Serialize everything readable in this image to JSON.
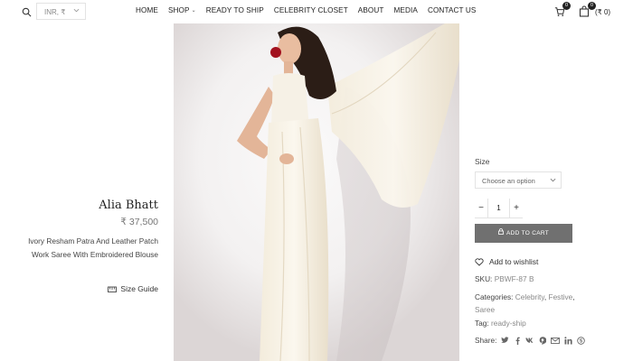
{
  "header": {
    "currency": "INR, ₹",
    "nav": [
      {
        "label": "HOME",
        "dropdown": false
      },
      {
        "label": "SHOP",
        "dropdown": true
      },
      {
        "label": "READY TO SHIP",
        "dropdown": false
      },
      {
        "label": "CELEBRITY CLOSET",
        "dropdown": false
      },
      {
        "label": "ABOUT",
        "dropdown": false
      },
      {
        "label": "MEDIA",
        "dropdown": false
      },
      {
        "label": "CONTACT US",
        "dropdown": false
      }
    ],
    "wishlist_count": "0",
    "cart_count": "0",
    "cart_total": "(₹ 0)"
  },
  "product": {
    "title": "Alia Bhatt",
    "price": "₹ 37,500",
    "description": "Ivory Resham Patra And Leather Patch Work Saree With Embroidered Blouse",
    "size_guide": "Size Guide",
    "size_label": "Size",
    "size_placeholder": "Choose an option",
    "quantity": "1",
    "qty_minus": "−",
    "qty_plus": "+",
    "add_to_cart": "ADD TO CART",
    "wishlist": "Add to wishlist",
    "sku_label": "SKU:",
    "sku": "PBWF-87 B",
    "categories_label": "Categories:",
    "categories": [
      "Celebrity",
      "Festive",
      "Saree"
    ],
    "tag_label": "Tag:",
    "tag": "ready-ship",
    "share_label": "Share:"
  },
  "share_icons": [
    "twitter-icon",
    "facebook-icon",
    "vk-icon",
    "pinterest-icon",
    "email-icon",
    "linkedin-icon",
    "skype-icon"
  ],
  "colors": {
    "button": "#707070",
    "text": "#222222",
    "muted": "#888888"
  }
}
